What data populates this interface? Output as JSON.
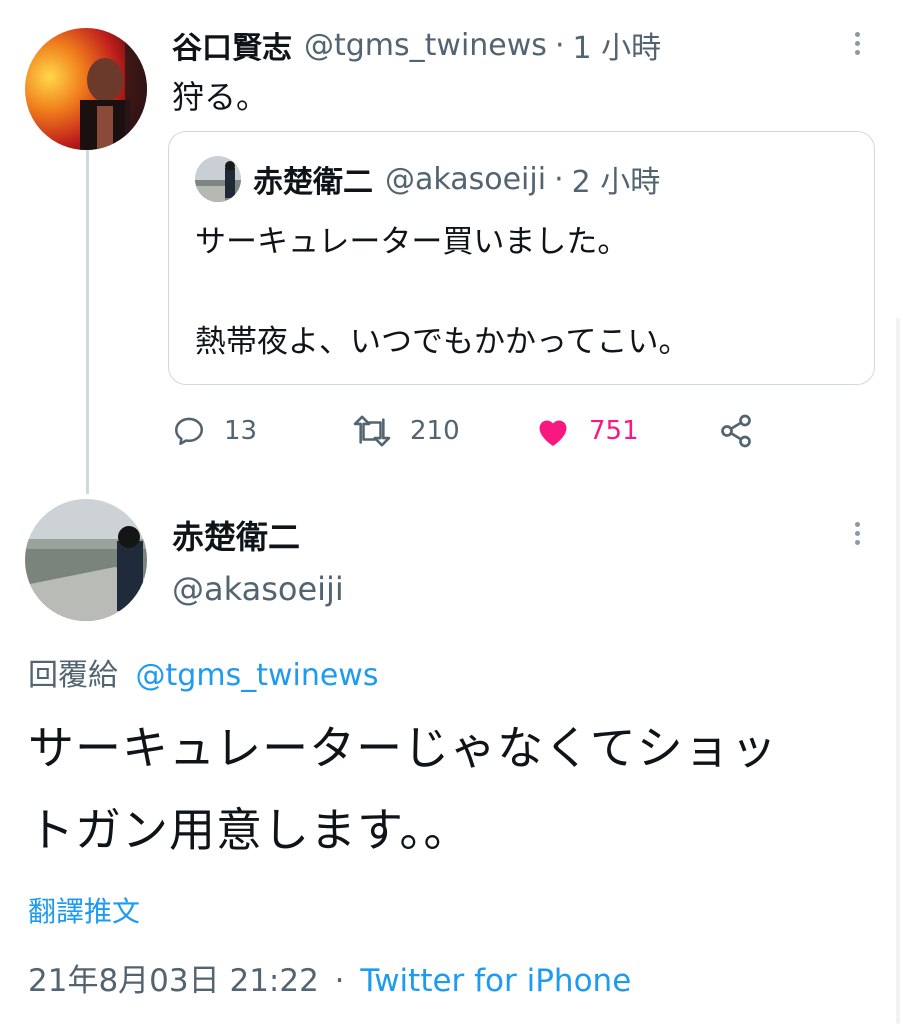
{
  "parent_tweet": {
    "display_name": "谷口賢志",
    "handle": "@tgms_twinews",
    "separator": "·",
    "time": "1 小時",
    "text": "狩る。"
  },
  "quoted_tweet": {
    "display_name": "赤楚衛二",
    "handle": "@akasoeiji",
    "separator": "·",
    "time": "2 小時",
    "line1": "サーキュレーター買いました。",
    "line2": "熱帯夜よ、いつでもかかってこい。"
  },
  "actions": {
    "replies": "13",
    "retweets": "210",
    "likes": "751",
    "like_color": "#f91880"
  },
  "reply_tweet": {
    "display_name": "赤楚衛二",
    "handle": "@akasoeiji",
    "replying_to_label": "回覆給",
    "replying_to_handle": "@tgms_twinews",
    "text_line1": "サーキュレーターじゃなくてショッ",
    "text_line2": "トガン用意します。。",
    "translate": "翻譯推文",
    "timestamp": "21年8月03日 21:22",
    "separator": "·",
    "source": "Twitter for iPhone"
  },
  "colors": {
    "accent": "#1d9bf0",
    "secondary_text": "#536471",
    "border": "#cfd9de"
  },
  "icons": [
    "more-icon",
    "reply-icon",
    "retweet-icon",
    "like-icon",
    "share-icon"
  ]
}
